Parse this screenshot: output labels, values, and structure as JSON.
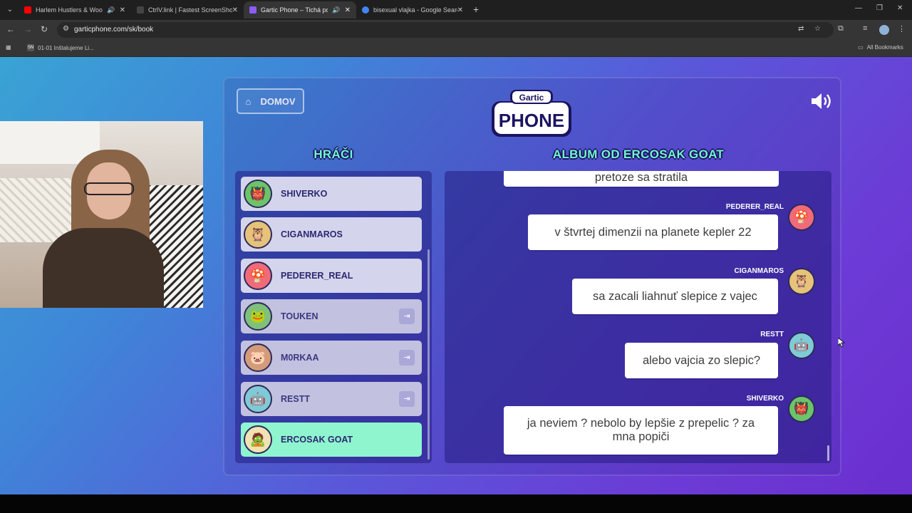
{
  "browser": {
    "tabs": [
      {
        "title": "Harlem Hustlers & Woody",
        "fav_color": "#ff0000",
        "audio": true,
        "active": false
      },
      {
        "title": "CtrlV.link | Fastest ScreenShot a",
        "fav_color": "#444444",
        "audio": false,
        "active": false
      },
      {
        "title": "Gartic Phone – Tichá pošta",
        "fav_color": "#8b5cf6",
        "audio": true,
        "active": true
      },
      {
        "title": "bisexual vlajka - Google Search",
        "fav_color": "#4285f4",
        "audio": false,
        "active": false
      }
    ],
    "url": "garticphone.com/sk/book",
    "bookmark_item": "01-01 Inštalujeme Li...",
    "all_bookmarks": "All Bookmarks"
  },
  "game": {
    "home_label": "DOMOV",
    "logo_top": "Gartic",
    "logo_bottom": "PHONE",
    "players_title": "HRÁČI",
    "album_title": "ALBUM OD ERCOSAK GOAT",
    "players": [
      {
        "name": "SHIVERKO",
        "status": "online",
        "avatar": "green-ogre"
      },
      {
        "name": "CIGANMAROS",
        "status": "online",
        "avatar": "owl"
      },
      {
        "name": "PEDERER_REAL",
        "status": "online",
        "avatar": "mushroom"
      },
      {
        "name": "TOUKEN",
        "status": "offline",
        "avatar": "frog"
      },
      {
        "name": "M0RKAA",
        "status": "offline",
        "avatar": "pig"
      },
      {
        "name": "RESTT",
        "status": "offline",
        "avatar": "robot"
      },
      {
        "name": "ERCOSAK GOAT",
        "status": "active",
        "avatar": "mummy"
      }
    ],
    "messages": [
      {
        "author": "",
        "text": "pretoze sa stratila"
      },
      {
        "author": "PEDERER_REAL",
        "text": "v štvrtej dimenzii na planete kepler 22"
      },
      {
        "author": "CIGANMAROS",
        "text": "sa zacali liahnuť slepice z vajec"
      },
      {
        "author": "RESTT",
        "text": "alebo vajcia zo slepic?"
      },
      {
        "author": "SHIVERKO",
        "text": "ja neviem ? nebolo by lepšie z prepelic ? za mna popiči"
      }
    ]
  },
  "colors": {
    "accent": "#6ff6ce",
    "active_player": "#8ff5cf",
    "panel": "#241e82"
  }
}
